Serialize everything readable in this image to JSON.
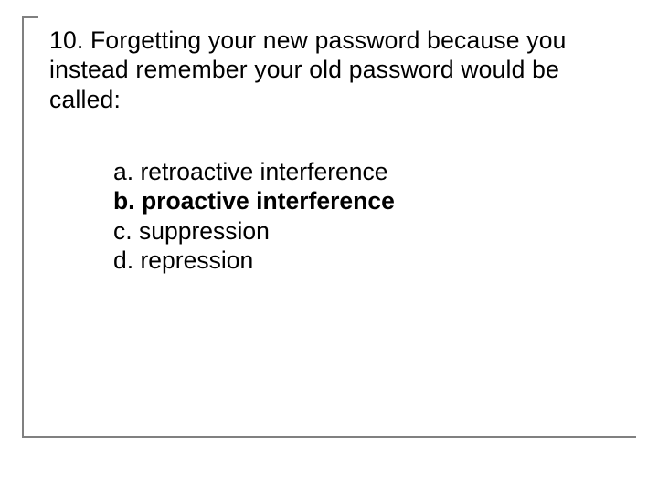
{
  "question": {
    "number": "10.",
    "text_line1": "10. Forgetting your new password because you",
    "text_line2": "instead remember your old password would be",
    "text_line3": "called:"
  },
  "options": {
    "a": {
      "label": "a.",
      "text": "retroactive interference",
      "correct": false
    },
    "b": {
      "label": "b.",
      "text": "proactive interference",
      "correct": true
    },
    "c": {
      "label": "c.",
      "text": "suppression",
      "correct": false
    },
    "d": {
      "label": "d.",
      "text": "repression",
      "correct": false
    }
  }
}
